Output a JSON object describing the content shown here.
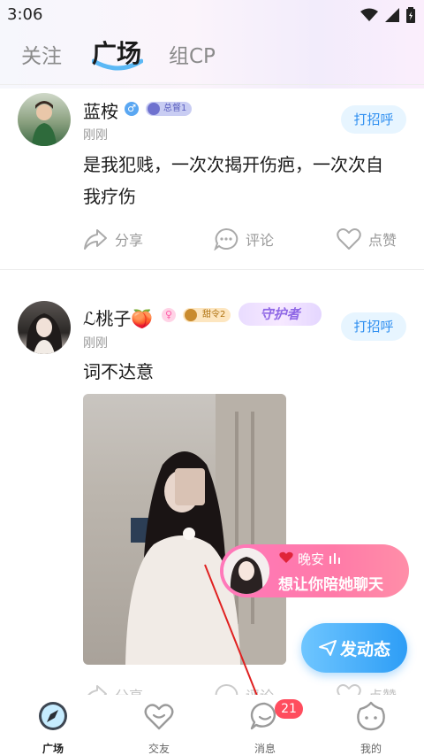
{
  "status": {
    "time": "3:06"
  },
  "tabs": [
    {
      "label": "关注"
    },
    {
      "label": "广场"
    },
    {
      "label": "组CP"
    }
  ],
  "posts": [
    {
      "username": "蓝桉",
      "rank_badge": "总督1",
      "time": "刚刚",
      "text_line1": "是我犯贱，一次次揭开伤疤，一次次自",
      "text_line2": "我疗伤",
      "greet": "打招呼",
      "actions": {
        "share": "分享",
        "comment": "评论",
        "like": "点赞"
      }
    },
    {
      "username": "ℒ桃子🍑",
      "level_badge": "甜令2",
      "guard_badge": "守护者",
      "time": "刚刚",
      "text": "词不达意",
      "greet": "打招呼",
      "actions": {
        "share": "分享",
        "comment": "评论",
        "like": "点赞"
      }
    }
  ],
  "float_banner": {
    "title": "晚安",
    "subtitle": "想让你陪她聊天"
  },
  "post_button": "发动态",
  "bottom_nav": [
    {
      "label": "广场",
      "icon": "compass-icon"
    },
    {
      "label": "交友",
      "icon": "heart-icon"
    },
    {
      "label": "消息",
      "icon": "chat-icon",
      "badge": "21"
    },
    {
      "label": "我的",
      "icon": "face-icon"
    }
  ],
  "colors": {
    "accent": "#2f8ff0",
    "pink": "#ff78ba",
    "badge_red": "#ff4d5e"
  }
}
